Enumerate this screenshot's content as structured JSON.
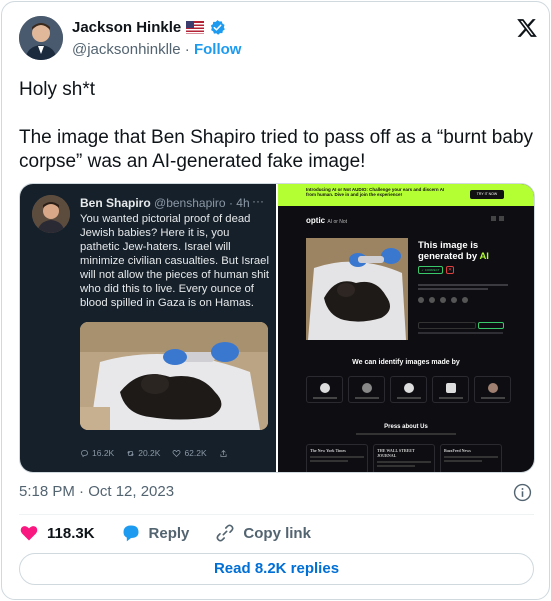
{
  "author": {
    "name": "Jackson Hinkle",
    "handle": "@jacksonhinklle",
    "separator": "·",
    "follow_label": "Follow"
  },
  "tweet": {
    "text": "Holy sh*t\n\nThe image that Ben Shapiro tried to pass off as a “burnt baby corpse” was an AI-generated fake image!",
    "timestamp": "5:18 PM · Oct 12, 2023"
  },
  "embedded_tweet": {
    "name": "Ben Shapiro",
    "handle": "@benshapiro",
    "age": "· 4h",
    "menu": "···",
    "text": "You wanted pictorial proof of dead Jewish babies? Here it is, you pathetic Jew-haters. Israel will minimize civilian casualties. But Israel will not allow the pieces of human shit who did this to live. Every ounce of blood spilled in Gaza is on Hamas.",
    "replies": "16.2K",
    "retweets": "20.2K",
    "likes": "62.2K"
  },
  "optic_page": {
    "banner_text": "Introducing AI or Not AUDIO: Challenge your ears and discern AI from human. Dive in and join the experience!",
    "banner_button": "TRY IT NOW",
    "logo": "optic",
    "logo_sub": "AI or Not",
    "result_line1": "This image is",
    "result_line2": "generated by",
    "result_ai": "AI",
    "correct_chip": "✓ CORRECT",
    "wrong_chip": "✕",
    "identify_heading": "We can identify images made by",
    "press_heading": "Press about Us",
    "press_outlets": [
      "The New York Times",
      "THE WALL STREET JOURNAL",
      "BuzzFeed News"
    ]
  },
  "engagement": {
    "likes": "118.3K",
    "reply_label": "Reply",
    "copy_label": "Copy link",
    "read_replies": "Read 8.2K replies"
  },
  "colors": {
    "accent": "#1d9bf0",
    "like": "#f91880",
    "optic_green": "#b3ff33"
  }
}
